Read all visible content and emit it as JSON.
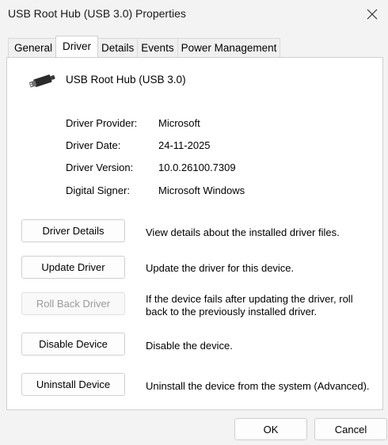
{
  "window": {
    "title": "USB Root Hub (USB 3.0) Properties"
  },
  "tabs": [
    {
      "label": "General"
    },
    {
      "label": "Driver"
    },
    {
      "label": "Details"
    },
    {
      "label": "Events"
    },
    {
      "label": "Power Management"
    }
  ],
  "active_tab": "Driver",
  "device": {
    "name": "USB Root Hub (USB 3.0)",
    "icon": "usb-plug-icon"
  },
  "info": [
    {
      "label": "Driver Provider:",
      "value": "Microsoft"
    },
    {
      "label": "Driver Date:",
      "value": "24-11-2025"
    },
    {
      "label": "Driver Version:",
      "value": "10.0.26100.7309"
    },
    {
      "label": "Digital Signer:",
      "value": "Microsoft Windows"
    }
  ],
  "actions": [
    {
      "label": "Driver Details",
      "description": "View details about the installed driver files.",
      "enabled": true
    },
    {
      "label": "Update Driver",
      "description": "Update the driver for this device.",
      "enabled": true
    },
    {
      "label": "Roll Back Driver",
      "description": "If the device fails after updating the driver, roll back to the previously installed driver.",
      "enabled": false
    },
    {
      "label": "Disable Device",
      "description": "Disable the device.",
      "enabled": true
    },
    {
      "label": "Uninstall Device",
      "description": "Uninstall the device from the system (Advanced).",
      "enabled": true
    }
  ],
  "footer": {
    "ok_label": "OK",
    "cancel_label": "Cancel"
  },
  "colors": {
    "window_bg": "#f3f3f3",
    "panel_bg": "#ffffff",
    "disabled_text": "#9a9a9a"
  }
}
